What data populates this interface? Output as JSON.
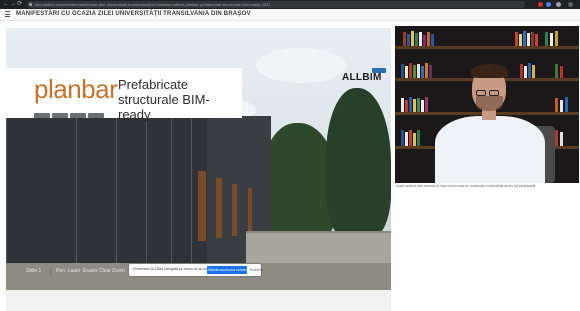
{
  "browser": {
    "nav_back": "←",
    "nav_forward": "→",
    "nav_reload": "⟳",
    "url": "fdm.unitbv.ro/conferinte/manifestari-zilei-universitatii-transilvania/live?session=allbim-planbar-prefabricate-structurale-bim-ready-2021"
  },
  "meeting": {
    "title": "MANIFESTĂRI CU OCAZIA ZILEI UNIVERSITĂȚII TRANSILVANIA DIN BRAȘOV"
  },
  "slide": {
    "logo": "planbar",
    "headline_line1": "Prefabricate",
    "headline_line2": "structurale BIM-ready",
    "brand": "ALLBIM"
  },
  "toolbar": {
    "items": [
      "Slide 1",
      "Pen",
      "Laser",
      "Eraser",
      "Clear",
      "Zoom"
    ]
  },
  "notification": {
    "text": "Prezentare ALLBIM partajată pe ecran de la vorbitor",
    "button": "Solicită accesul la control",
    "dismiss": "Închide"
  },
  "video": {
    "caption": "Acest conținut este transmis în timp real din sala de conferință a universității pentru toți participanții"
  },
  "colors": {
    "accent": "#1a73e8",
    "logo_orange": "#c9722c",
    "topbar": "#202124",
    "brand_blue": "#2b6fb0"
  },
  "icons": {
    "menu": "menu-icon",
    "lock": "lock-icon",
    "extensions": [
      "extension-red-icon",
      "extension-blue-icon",
      "extension-gray-icon",
      "extension-dark-icon"
    ]
  }
}
